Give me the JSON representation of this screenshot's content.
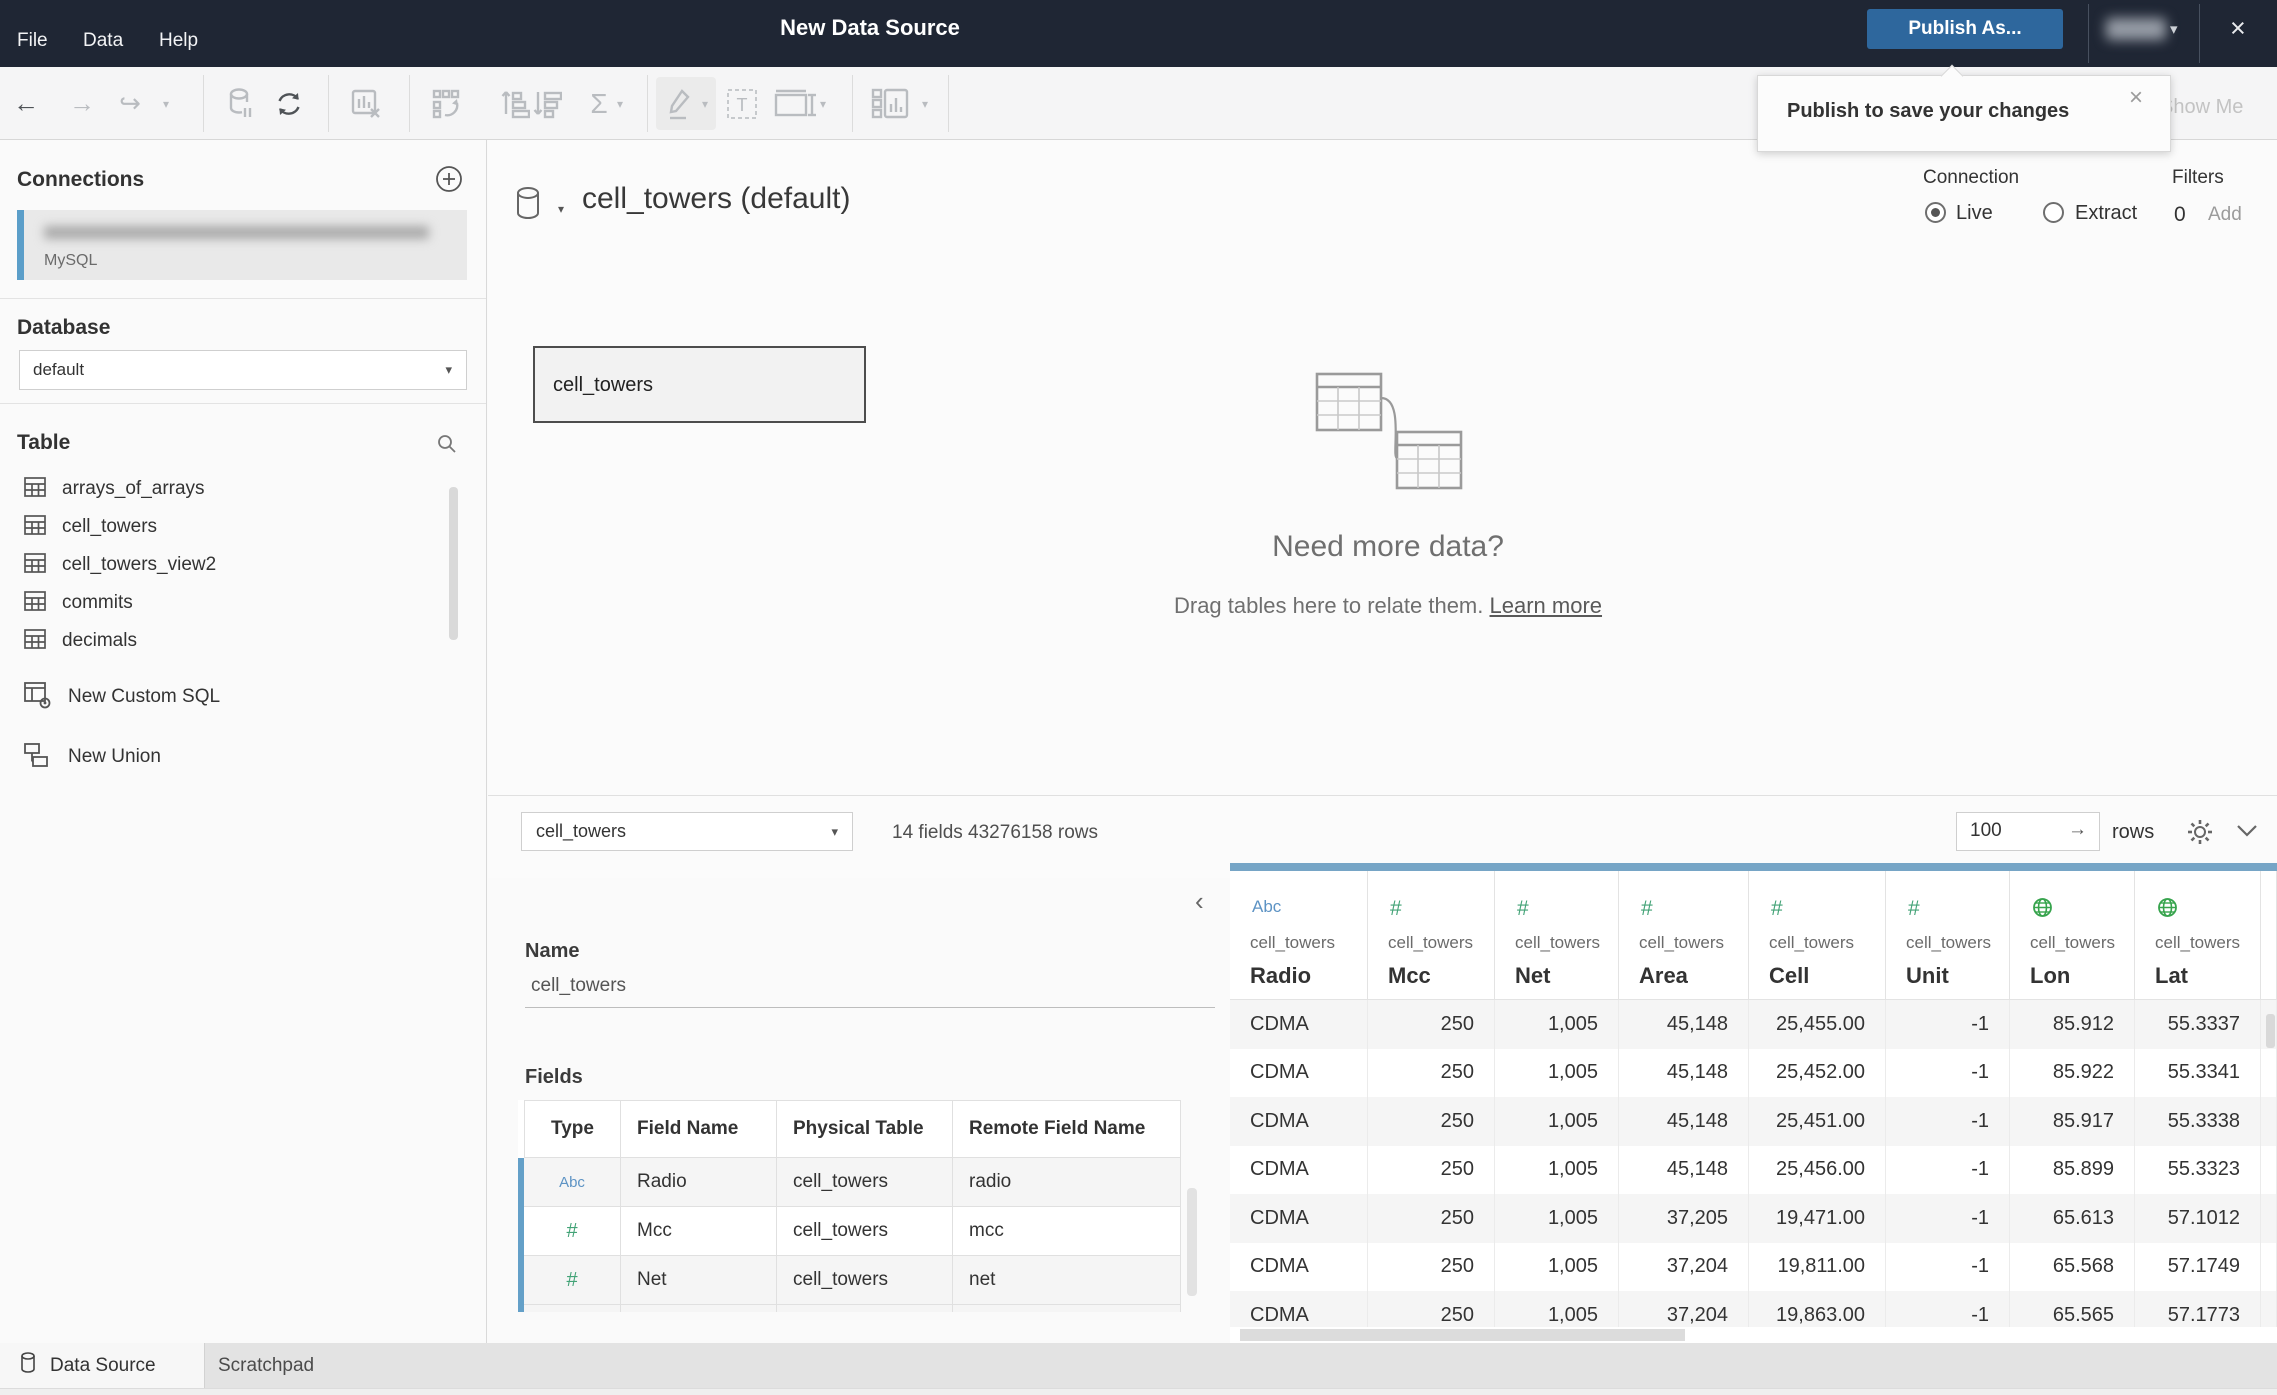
{
  "titlebar": {
    "menus": [
      "File",
      "Data",
      "Help"
    ],
    "title": "New Data Source",
    "publish_label": "Publish As...",
    "user_caret": "▾",
    "close_glyph": "×"
  },
  "tooltip": {
    "text": "Publish to save your changes",
    "close_glyph": "×"
  },
  "toolbar": {
    "show_me_label": "Show Me",
    "glyphs": {
      "back": "←",
      "forward": "→",
      "redo": "↪",
      "caret": "▾",
      "sigma": "Σ"
    }
  },
  "sidebar": {
    "connections_title": "Connections",
    "connection": {
      "subtitle": "MySQL"
    },
    "database_label": "Database",
    "database_value": "default",
    "database_caret": "▾",
    "table_label": "Table",
    "tables": [
      "arrays_of_arrays",
      "cell_towers",
      "cell_towers_view2",
      "commits",
      "decimals"
    ],
    "new_custom_sql": "New Custom SQL",
    "new_union": "New Union"
  },
  "canvas": {
    "title": "cell_towers (default)",
    "title_caret": "▾",
    "node_label": "cell_towers",
    "connection_label": "Connection",
    "live_label": "Live",
    "extract_label": "Extract",
    "selected_connection": "Live",
    "filters_label": "Filters",
    "filters_count": "0",
    "filters_add": "Add",
    "empty_heading": "Need more data?",
    "empty_body": "Drag tables here to relate them.",
    "empty_link": "Learn more"
  },
  "preview_bar": {
    "table_selector": "cell_towers",
    "selector_caret": "▾",
    "summary": "14 fields 43276158 rows",
    "row_count": "100",
    "row_arrow": "→",
    "rows_label": "rows"
  },
  "metadata": {
    "collapse_glyph": "‹",
    "name_label": "Name",
    "name_value": "cell_towers",
    "fields_label": "Fields",
    "columns": [
      "Type",
      "Field Name",
      "Physical Table",
      "Remote Field Name"
    ],
    "rows": [
      {
        "type": "Abc",
        "type_kind": "string",
        "field": "Radio",
        "table": "cell_towers",
        "remote": "radio"
      },
      {
        "type": "#",
        "type_kind": "number",
        "field": "Mcc",
        "table": "cell_towers",
        "remote": "mcc"
      },
      {
        "type": "#",
        "type_kind": "number",
        "field": "Net",
        "table": "cell_towers",
        "remote": "net"
      }
    ]
  },
  "grid": {
    "columns": [
      {
        "type": "string",
        "table": "cell_towers",
        "name": "Radio"
      },
      {
        "type": "number",
        "table": "cell_towers",
        "name": "Mcc"
      },
      {
        "type": "number",
        "table": "cell_towers",
        "name": "Net"
      },
      {
        "type": "number",
        "table": "cell_towers",
        "name": "Area"
      },
      {
        "type": "number",
        "table": "cell_towers",
        "name": "Cell"
      },
      {
        "type": "number",
        "table": "cell_towers",
        "name": "Unit"
      },
      {
        "type": "geo",
        "table": "cell_towers",
        "name": "Lon"
      },
      {
        "type": "geo",
        "table": "cell_towers",
        "name": "Lat"
      }
    ],
    "rows": [
      [
        "CDMA",
        "250",
        "1,005",
        "45,148",
        "25,455.00",
        "-1",
        "85.912",
        "55.3337"
      ],
      [
        "CDMA",
        "250",
        "1,005",
        "45,148",
        "25,452.00",
        "-1",
        "85.922",
        "55.3341"
      ],
      [
        "CDMA",
        "250",
        "1,005",
        "45,148",
        "25,451.00",
        "-1",
        "85.917",
        "55.3338"
      ],
      [
        "CDMA",
        "250",
        "1,005",
        "45,148",
        "25,456.00",
        "-1",
        "85.899",
        "55.3323"
      ],
      [
        "CDMA",
        "250",
        "1,005",
        "37,205",
        "19,471.00",
        "-1",
        "65.613",
        "57.1012"
      ],
      [
        "CDMA",
        "250",
        "1,005",
        "37,204",
        "19,811.00",
        "-1",
        "65.568",
        "57.1749"
      ],
      [
        "CDMA",
        "250",
        "1,005",
        "37,204",
        "19,863.00",
        "-1",
        "65.565",
        "57.1773"
      ]
    ]
  },
  "tabs": {
    "data_source": "Data Source",
    "scratchpad": "Scratchpad"
  },
  "colors": {
    "titlebar_bg": "#1f2634",
    "accent_blue": "#2e679d",
    "grid_header_bar": "#76a5c6",
    "string_blue": "#5d93c4",
    "number_green": "#43a377",
    "geo_green": "#37a44d",
    "selected_row_bar": "#64a0c8"
  }
}
